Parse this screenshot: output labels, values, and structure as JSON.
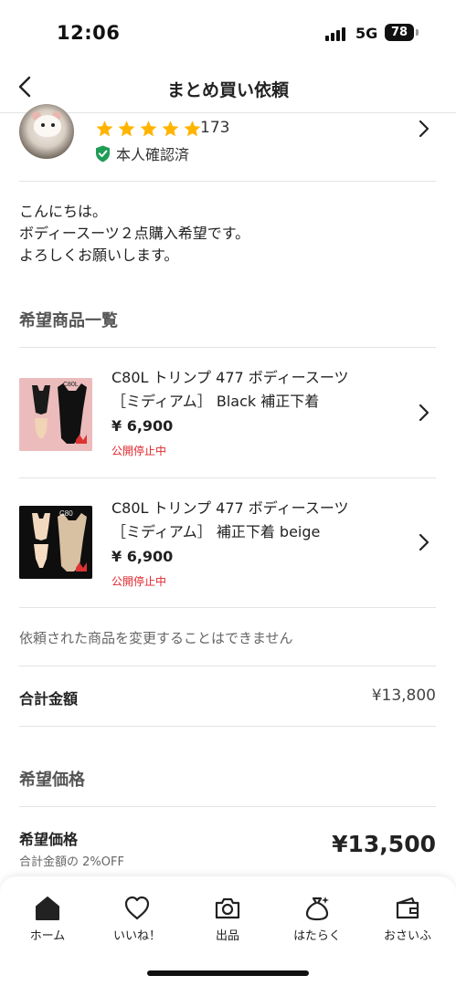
{
  "status_bar": {
    "time": "12:06",
    "network": "5G",
    "battery": "78"
  },
  "nav": {
    "title": "まとめ買い依頼",
    "back_icon": "chevron-left-icon"
  },
  "seller": {
    "rating_stars": 5,
    "rating_count": "173",
    "verified_label": "本人確認済",
    "star_color": "#ffb400",
    "verified_color": "#1f9d55"
  },
  "message": {
    "line1": "こんにちは。",
    "line2": "ボディースーツ２点購入希望です。",
    "line3": "よろしくお願いします。"
  },
  "items_section": {
    "heading": "希望商品一覧"
  },
  "items": [
    {
      "title_line1": "C80L トリンプ 477 ボディースーツ",
      "title_line2": "［ミディアム］ Black 補正下着",
      "price": "¥ 6,900",
      "status": "公開停止中"
    },
    {
      "title_line1": "C80L トリンプ 477 ボディースーツ",
      "title_line2": "［ミディアム］ 補正下着 beige",
      "price": "¥ 6,900",
      "status": "公開停止中"
    }
  ],
  "notice": "依頼された商品を変更することはできません",
  "total": {
    "label": "合計金額",
    "value": "¥13,800"
  },
  "desired_section": {
    "heading": "希望価格"
  },
  "desired": {
    "label": "希望価格",
    "sub": "合計金額の 2%OFF",
    "value": "¥13,500"
  },
  "tab_bar": {
    "tabs": [
      {
        "label": "ホーム",
        "icon": "home-icon"
      },
      {
        "label": "いいね！",
        "icon": "heart-icon"
      },
      {
        "label": "出品",
        "icon": "camera-icon"
      },
      {
        "label": "はたらく",
        "icon": "money-bag-icon"
      },
      {
        "label": "おさいふ",
        "icon": "wallet-icon"
      }
    ]
  },
  "colors": {
    "status_red": "#e0262d",
    "divider": "#e3e3e3"
  }
}
